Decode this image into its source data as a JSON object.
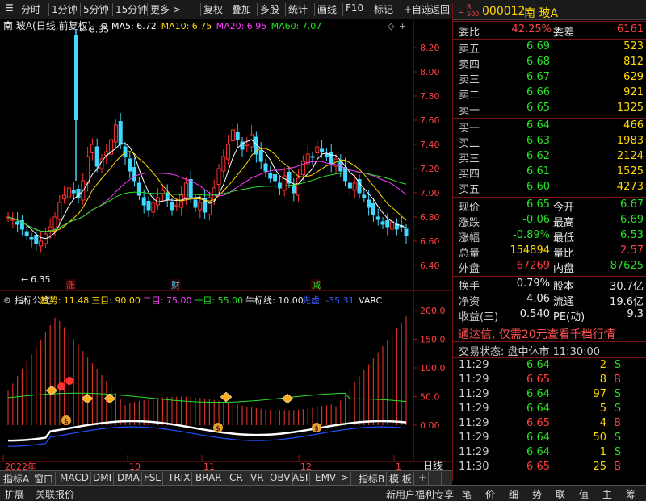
{
  "toolbar": {
    "items": [
      "分时",
      "1分钟",
      "5分钟",
      "15分钟",
      "更多 >",
      "复权",
      "叠加",
      "多股",
      "统计",
      "画线",
      "F10",
      "标记",
      "+自选",
      "返回"
    ]
  },
  "chart": {
    "title": "南 玻A(日线,前复权)",
    "ma": [
      {
        "label": "MA5: 6.72",
        "color": "#ffffff"
      },
      {
        "label": "MA10: 6.75",
        "color": "#ffd800"
      },
      {
        "label": "MA20: 6.95",
        "color": "#ff3cff"
      },
      {
        "label": "MA60: 7.07",
        "color": "#28e028"
      }
    ],
    "price_axis": [
      "8.20",
      "8.00",
      "7.80",
      "7.60",
      "7.40",
      "7.20",
      "7.00",
      "6.80",
      "6.60",
      "6.40"
    ],
    "high_label": "8.35",
    "low_label": "6.35",
    "events": [
      {
        "text": "涨",
        "color": "#ff4040"
      },
      {
        "text": "财",
        "color": "#3ed0ff"
      },
      {
        "text": "减",
        "color": "#28e028"
      }
    ],
    "indicator_header": [
      {
        "text": "指标公式",
        "color": "#e8e8e8"
      },
      {
        "text": "趋势: 11.48",
        "color": "#ffd800"
      },
      {
        "text": "三目: 90.00",
        "color": "#ffd800"
      },
      {
        "text": "二目: 75.00",
        "color": "#ff3cff"
      },
      {
        "text": "一目: 55.00",
        "color": "#28e028"
      },
      {
        "text": "牛标线: 10.00",
        "color": "#e8e8e8"
      },
      {
        "text": "先虚: -35.31",
        "color": "#3b5bff"
      },
      {
        "text": "VARC",
        "color": "#e8e8e8"
      }
    ],
    "ind_axis": [
      "200.0",
      "150.0",
      "100.0",
      "50.0",
      "0.00"
    ],
    "date_labels": [
      "2022年",
      "10",
      "11",
      "12",
      "1"
    ],
    "period_label": "日线"
  },
  "tabs": [
    "指标A",
    "窗口",
    "MACD",
    "DMI",
    "DMA",
    "FSL",
    "TRIX",
    "BRAR",
    "CR",
    "VR",
    "OBV",
    "ASI",
    "EMV",
    ">",
    "指标B",
    "模 板",
    "+",
    "-"
  ],
  "status": {
    "left": [
      "扩展",
      "关联报价"
    ],
    "center": "新用户福利专享",
    "right": [
      "笔",
      "价",
      "细",
      "势",
      "联",
      "值",
      "主",
      "筹"
    ]
  },
  "quote": {
    "code": "000012",
    "name": "南 玻A",
    "webi": {
      "label": "委比",
      "value": "42.25%",
      "diff_label": "委差",
      "diff": "6161"
    },
    "sells": [
      {
        "label": "卖五",
        "price": "6.69",
        "vol": "523"
      },
      {
        "label": "卖四",
        "price": "6.68",
        "vol": "812"
      },
      {
        "label": "卖三",
        "price": "6.67",
        "vol": "629"
      },
      {
        "label": "卖二",
        "price": "6.66",
        "vol": "921"
      },
      {
        "label": "卖一",
        "price": "6.65",
        "vol": "1325"
      }
    ],
    "buys": [
      {
        "label": "买一",
        "price": "6.64",
        "vol": "466"
      },
      {
        "label": "买二",
        "price": "6.63",
        "vol": "1983"
      },
      {
        "label": "买三",
        "price": "6.62",
        "vol": "2124"
      },
      {
        "label": "买四",
        "price": "6.61",
        "vol": "1525"
      },
      {
        "label": "买五",
        "price": "6.60",
        "vol": "4273"
      }
    ],
    "stats1": [
      {
        "l1": "现价",
        "v1": "6.65",
        "c1": "green",
        "l2": "今开",
        "v2": "6.67",
        "c2": "green"
      },
      {
        "l1": "涨跌",
        "v1": "-0.06",
        "c1": "green",
        "l2": "最高",
        "v2": "6.69",
        "c2": "green"
      },
      {
        "l1": "涨幅",
        "v1": "-0.89%",
        "c1": "green",
        "l2": "最低",
        "v2": "6.53",
        "c2": "green"
      },
      {
        "l1": "总量",
        "v1": "154894",
        "c1": "yellow",
        "l2": "量比",
        "v2": "2.57",
        "c2": "red"
      },
      {
        "l1": "外盘",
        "v1": "67269",
        "c1": "red",
        "l2": "内盘",
        "v2": "87625",
        "c2": "green"
      }
    ],
    "stats2": [
      {
        "l1": "换手",
        "v1": "0.79%",
        "l2": "股本",
        "v2": "30.7亿"
      },
      {
        "l1": "净资",
        "v1": "4.06",
        "l2": "流通",
        "v2": "19.6亿"
      },
      {
        "l1": "收益(三)",
        "v1": "0.540",
        "l2": "PE(动)",
        "v2": "9.3"
      }
    ],
    "promo": "通达信, 仅需20元查看千档行情",
    "trade_state": "交易状态: 盘中休市 11:30:00",
    "ticks": [
      {
        "time": "11:29",
        "price": "6.64",
        "vol": "2",
        "side": "S"
      },
      {
        "time": "11:29",
        "price": "6.65",
        "vol": "8",
        "side": "B"
      },
      {
        "time": "11:29",
        "price": "6.64",
        "vol": "97",
        "side": "S"
      },
      {
        "time": "11:29",
        "price": "6.64",
        "vol": "5",
        "side": "S"
      },
      {
        "time": "11:29",
        "price": "6.65",
        "vol": "4",
        "side": "B"
      },
      {
        "time": "11:29",
        "price": "6.64",
        "vol": "50",
        "side": "S"
      },
      {
        "time": "11:29",
        "price": "6.64",
        "vol": "1",
        "side": "S"
      },
      {
        "time": "11:30",
        "price": "6.65",
        "vol": "25",
        "side": "B"
      }
    ]
  }
}
